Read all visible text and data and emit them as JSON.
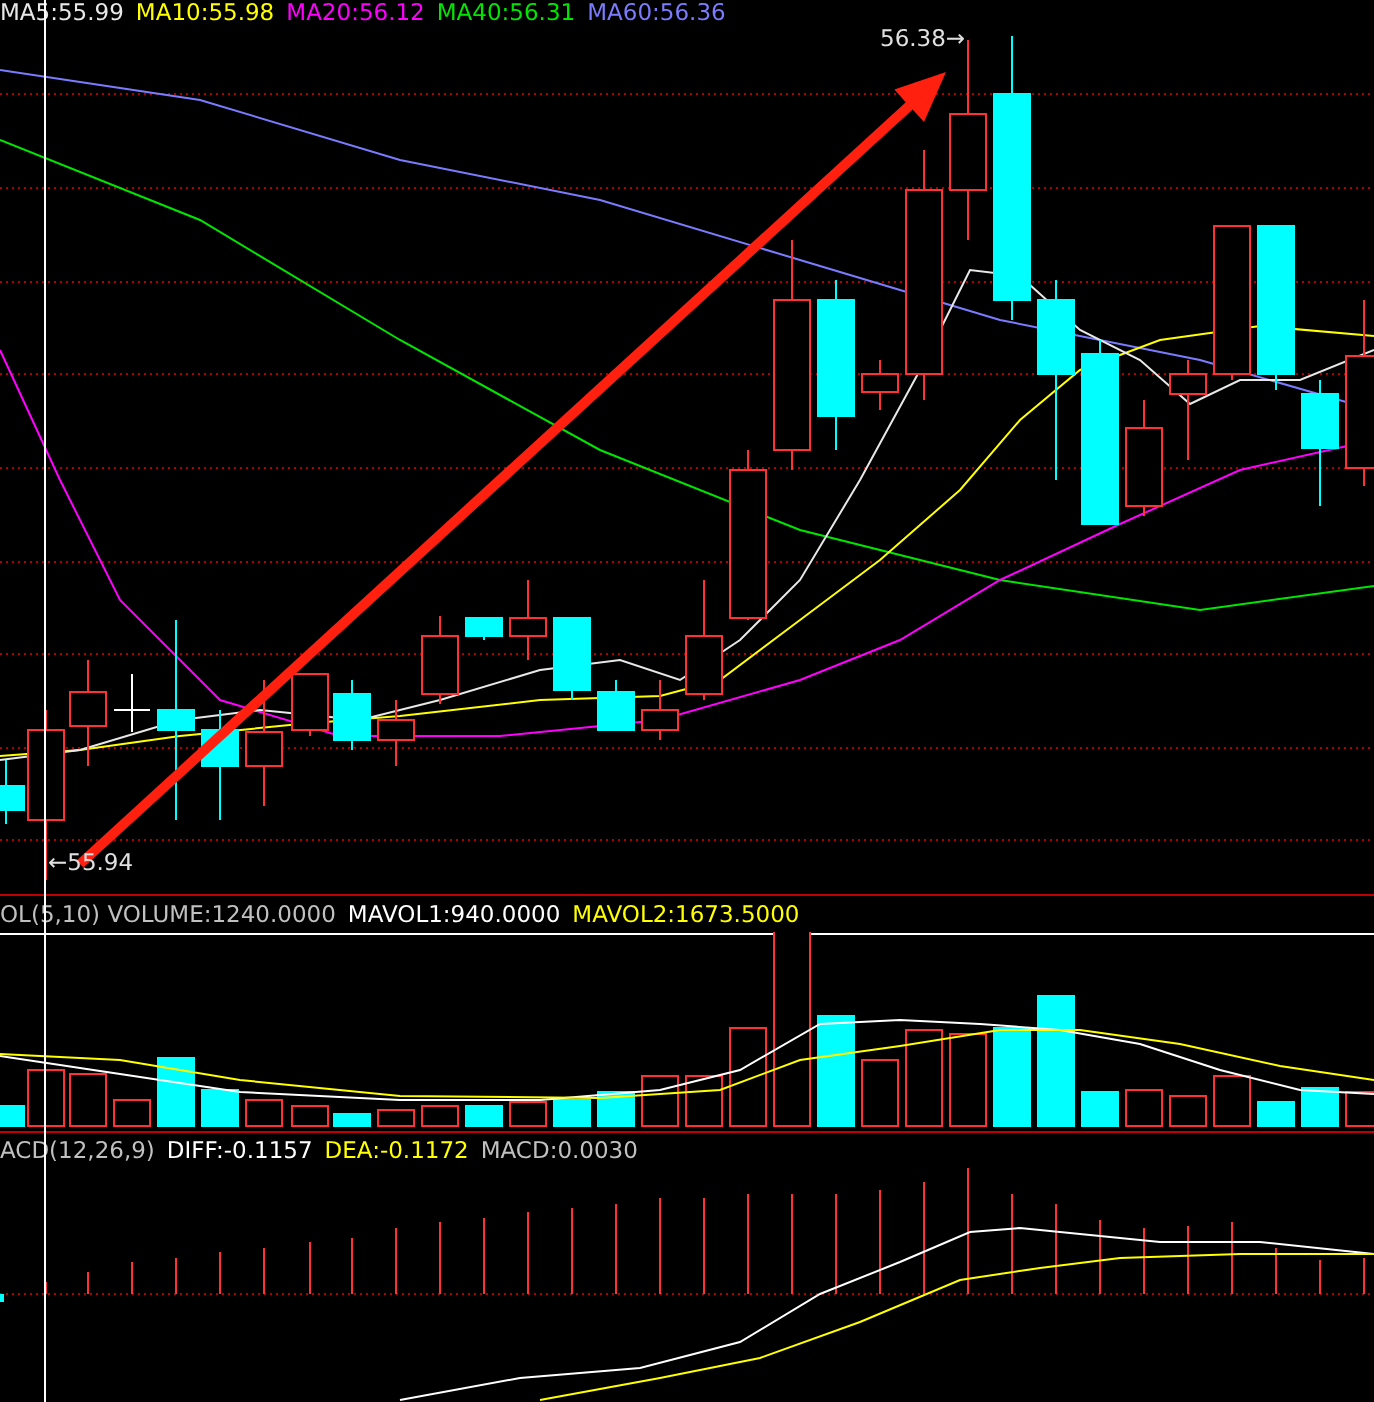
{
  "price_panel": {
    "legend": [
      {
        "text": "MA5:55.99",
        "color": "#e8e8e8"
      },
      {
        "text": "MA10:55.98",
        "color": "#ffff00"
      },
      {
        "text": "MA20:56.12",
        "color": "#ff00ff"
      },
      {
        "text": "MA40:56.31",
        "color": "#00e600"
      },
      {
        "text": "MA60:56.36",
        "color": "#7b7bff"
      }
    ],
    "high_label": "56.38→",
    "low_label": "←55.94"
  },
  "volume_panel": {
    "legend": [
      {
        "text": "OL(5,10) VOLUME:1240.0000",
        "color": "#c0c0c0"
      },
      {
        "text": "MAVOL1:940.0000",
        "color": "#ffffff"
      },
      {
        "text": "MAVOL2:1673.5000",
        "color": "#ffff00"
      }
    ]
  },
  "macd_panel": {
    "legend": [
      {
        "text": "ACD(12,26,9)",
        "color": "#c0c0c0"
      },
      {
        "text": "DIFF:-0.1157",
        "color": "#ffffff"
      },
      {
        "text": "DEA:-0.1172",
        "color": "#ffff00"
      },
      {
        "text": "MACD:0.0030",
        "color": "#c0c0c0"
      }
    ]
  }
}
